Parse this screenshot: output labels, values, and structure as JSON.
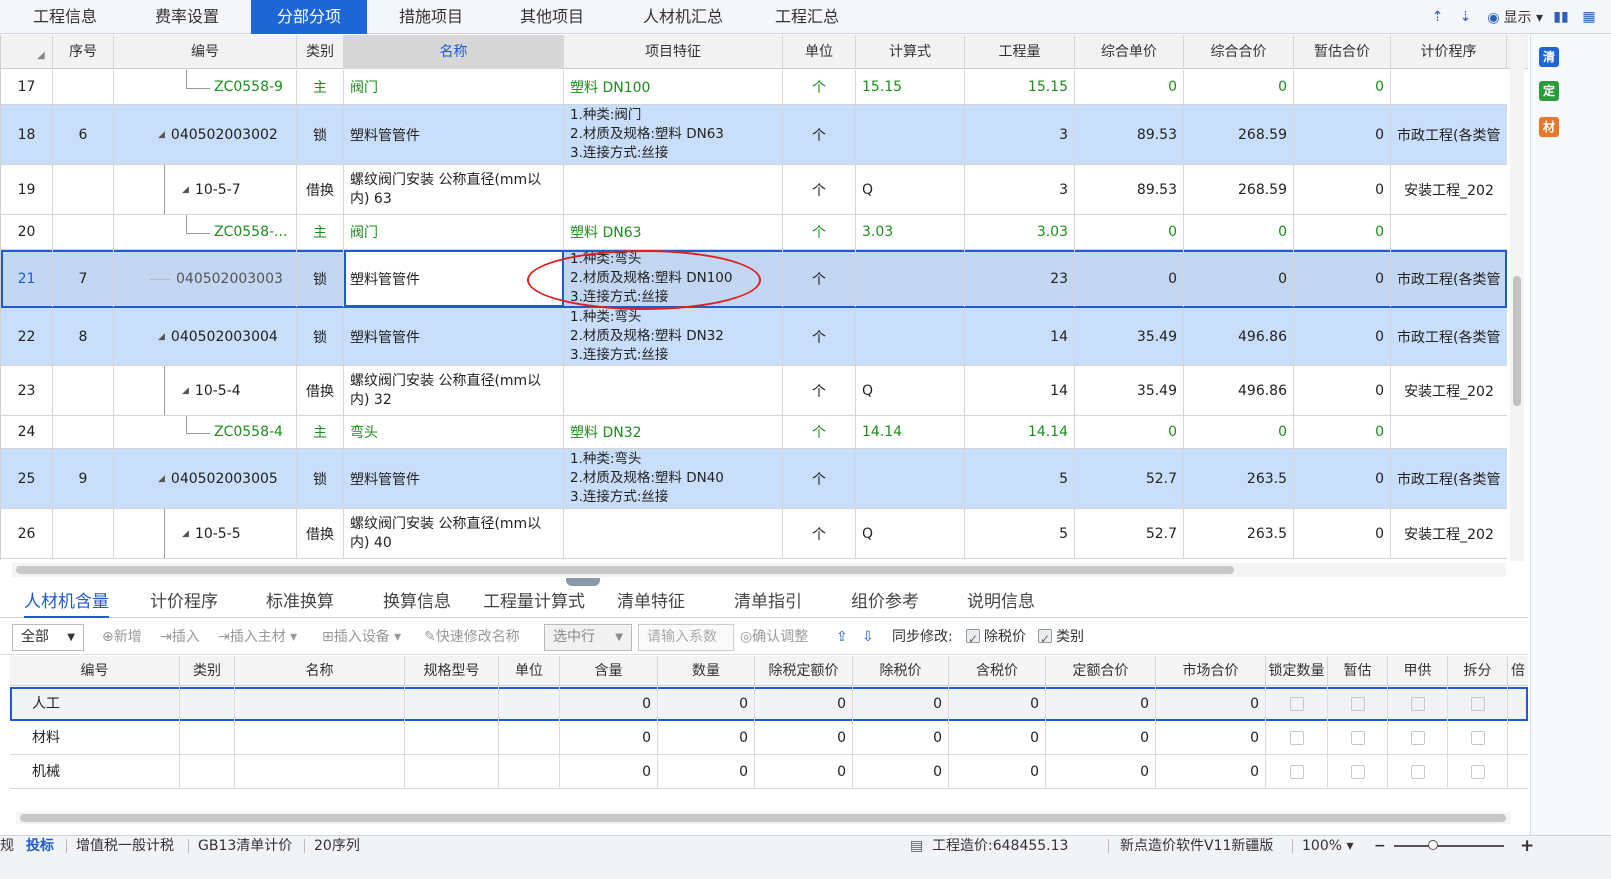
{
  "top_tabs": [
    {
      "label": "工程信息",
      "active": false
    },
    {
      "label": "费率设置",
      "active": false
    },
    {
      "label": "分部分项",
      "active": true
    },
    {
      "label": "措施项目",
      "active": false
    },
    {
      "label": "其他项目",
      "active": false
    },
    {
      "label": "人材机汇总",
      "active": false
    },
    {
      "label": "工程汇总",
      "active": false
    }
  ],
  "top_right": {
    "display_label": "显示"
  },
  "grid": {
    "headers": [
      "序号",
      "编号",
      "类别",
      "名称",
      "项目特征",
      "单位",
      "计算式",
      "工程量",
      "综合单价",
      "综合合价",
      "暂估合价",
      "计价程序"
    ],
    "rows": [
      {
        "rownum": "17",
        "seq": "",
        "code": "ZC0558-9",
        "type": "主",
        "name": "阀门",
        "feature": "塑料 DN100",
        "unit": "个",
        "formula": "15.15",
        "qty": "15.15",
        "price": "0",
        "total": "0",
        "est": "0",
        "program": ""
      },
      {
        "rownum": "18",
        "seq": "6",
        "code": "040502003002",
        "type": "锁",
        "name": "塑料管管件",
        "feature": "1.种类:阀门\n2.材质及规格:塑料  DN63\n3.连接方式:丝接",
        "unit": "个",
        "formula": "",
        "qty": "3",
        "price": "89.53",
        "total": "268.59",
        "est": "0",
        "program": "市政工程(各类管"
      },
      {
        "rownum": "19",
        "seq": "",
        "code": "10-5-7",
        "type": "借换",
        "name": "螺纹阀门安装 公称直径(mm以内) 63",
        "feature": "",
        "unit": "个",
        "formula": "Q",
        "qty": "3",
        "price": "89.53",
        "total": "268.59",
        "est": "0",
        "program": "安装工程_202"
      },
      {
        "rownum": "20",
        "seq": "",
        "code": "ZC0558-...",
        "type": "主",
        "name": "阀门",
        "feature": "塑料 DN63",
        "unit": "个",
        "formula": "3.03",
        "qty": "3.03",
        "price": "0",
        "total": "0",
        "est": "0",
        "program": ""
      },
      {
        "rownum": "21",
        "seq": "7",
        "code": "040502003003",
        "type": "锁",
        "name": "塑料管管件",
        "feature": "1.种类:弯头\n2.材质及规格:塑料 DN100\n3.连接方式:丝接",
        "unit": "个",
        "formula": "",
        "qty": "23",
        "price": "0",
        "total": "0",
        "est": "0",
        "program": "市政工程(各类管"
      },
      {
        "rownum": "22",
        "seq": "8",
        "code": "040502003004",
        "type": "锁",
        "name": "塑料管管件",
        "feature": "1.种类:弯头\n2.材质及规格:塑料 DN32\n3.连接方式:丝接",
        "unit": "个",
        "formula": "",
        "qty": "14",
        "price": "35.49",
        "total": "496.86",
        "est": "0",
        "program": "市政工程(各类管"
      },
      {
        "rownum": "23",
        "seq": "",
        "code": "10-5-4",
        "type": "借换",
        "name": "螺纹阀门安装 公称直径(mm以内) 32",
        "feature": "",
        "unit": "个",
        "formula": "Q",
        "qty": "14",
        "price": "35.49",
        "total": "496.86",
        "est": "0",
        "program": "安装工程_202"
      },
      {
        "rownum": "24",
        "seq": "",
        "code": "ZC0558-4",
        "type": "主",
        "name": "弯头",
        "feature": "塑料 DN32",
        "unit": "个",
        "formula": "14.14",
        "qty": "14.14",
        "price": "0",
        "total": "0",
        "est": "0",
        "program": ""
      },
      {
        "rownum": "25",
        "seq": "9",
        "code": "040502003005",
        "type": "锁",
        "name": "塑料管管件",
        "feature": "1.种类:弯头\n2.材质及规格:塑料 DN40\n3.连接方式:丝接",
        "unit": "个",
        "formula": "",
        "qty": "5",
        "price": "52.7",
        "total": "263.5",
        "est": "0",
        "program": "市政工程(各类管"
      },
      {
        "rownum": "26",
        "seq": "",
        "code": "10-5-5",
        "type": "借换",
        "name": "螺纹阀门安装 公称直径(mm以内) 40",
        "feature": "",
        "unit": "个",
        "formula": "Q",
        "qty": "5",
        "price": "52.7",
        "total": "263.5",
        "est": "0",
        "program": "安装工程_202"
      }
    ]
  },
  "side_buttons": [
    {
      "label": "清",
      "color": "#1e66d6"
    },
    {
      "label": "定",
      "color": "#2a9d3a"
    },
    {
      "label": "材",
      "color": "#e8762b"
    }
  ],
  "bottom_tabs": [
    {
      "label": "人材机含量",
      "active": true
    },
    {
      "label": "计价程序",
      "active": false
    },
    {
      "label": "标准换算",
      "active": false
    },
    {
      "label": "换算信息",
      "active": false
    },
    {
      "label": "工程量计算式",
      "active": false
    },
    {
      "label": "清单特征",
      "active": false
    },
    {
      "label": "清单指引",
      "active": false
    },
    {
      "label": "组价参考",
      "active": false
    },
    {
      "label": "说明信息",
      "active": false
    }
  ],
  "toolbar": {
    "filter_value": "全部",
    "new_label": "新增",
    "insert_label": "插入",
    "insert_material_label": "插入主材",
    "insert_device_label": "插入设备",
    "quick_edit_label": "快速修改名称",
    "select_row_label": "选中行",
    "coef_placeholder": "请输入系数",
    "confirm_label": "确认调整",
    "sync_label": "同步修改:",
    "excl_tax_label": "除税价",
    "category_label": "类别"
  },
  "subgrid": {
    "headers": [
      "编号",
      "类别",
      "名称",
      "规格型号",
      "单位",
      "含量",
      "数量",
      "除税定额价",
      "除税价",
      "含税价",
      "定额合价",
      "市场合价",
      "锁定数量",
      "暂估",
      "甲供",
      "拆分",
      "倍"
    ],
    "rows": [
      {
        "code": "人工",
        "v1": "0",
        "v2": "0",
        "v3": "0",
        "v4": "0",
        "v5": "0",
        "v6": "0",
        "v7": "0"
      },
      {
        "code": "材料",
        "v1": "0",
        "v2": "0",
        "v3": "0",
        "v4": "0",
        "v5": "0",
        "v6": "0",
        "v7": "0"
      },
      {
        "code": "机械",
        "v1": "0",
        "v2": "0",
        "v3": "0",
        "v4": "0",
        "v5": "0",
        "v6": "0",
        "v7": "0"
      }
    ]
  },
  "status": {
    "edge": "规",
    "mode": "投标",
    "tax": "增值税一般计税",
    "standard": "GB13清单计价",
    "sequence": "20序列",
    "cost": "工程造价:648455.13",
    "software": "新点造价软件V11新疆版",
    "zoom": "100%"
  }
}
